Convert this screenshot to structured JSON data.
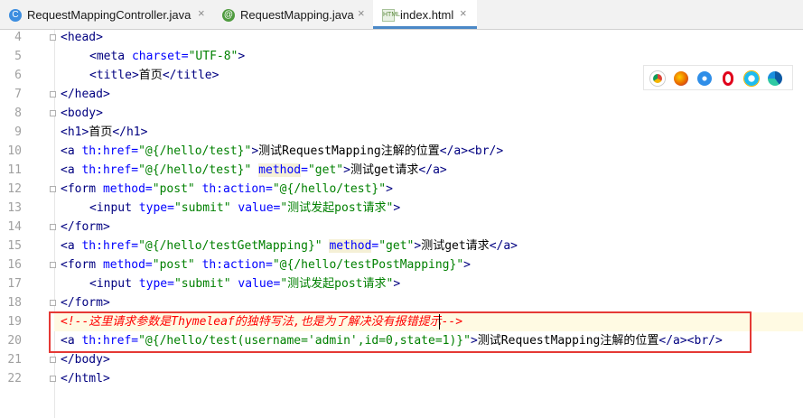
{
  "tabs": [
    {
      "label": "RequestMappingController.java",
      "icon": "java-class-icon",
      "active": false
    },
    {
      "label": "RequestMapping.java",
      "icon": "annotation-icon",
      "active": false
    },
    {
      "label": "index.html",
      "icon": "html-file-icon",
      "active": true
    }
  ],
  "tab_close_glyph": "×",
  "line_numbers": [
    "4",
    "5",
    "6",
    "7",
    "8",
    "9",
    "10",
    "11",
    "12",
    "13",
    "14",
    "15",
    "16",
    "17",
    "18",
    "19",
    "20",
    "21",
    "22"
  ],
  "code": {
    "l4": {
      "tag": "<head>"
    },
    "l5": {
      "t1": "<meta ",
      "a1": "charset=",
      "v1": "\"UTF-8\"",
      "t2": ">"
    },
    "l6": {
      "t1": "<title>",
      "x": "首页",
      "t2": "</title>"
    },
    "l7": {
      "tag": "</head>"
    },
    "l8": {
      "tag": "<body>"
    },
    "l9": {
      "t1": "<h1>",
      "x": "首页",
      "t2": "</h1>"
    },
    "l10": {
      "t1": "<a ",
      "a1": "th:href=",
      "v1": "\"@{/hello/test}\"",
      "t2": ">",
      "x": "测试RequestMapping注解的位置",
      "t3": "</a><br/>"
    },
    "l11": {
      "t1": "<a ",
      "a1": "th:href=",
      "v1": "\"@{/hello/test}\"",
      "sp": " ",
      "a2": "method",
      "a3": "=",
      "v2": "\"get\"",
      "t2": ">",
      "x": "测试get请求",
      "t3": "</a>"
    },
    "l12": {
      "t1": "<form ",
      "a1": "method=",
      "v1": "\"post\"",
      "sp": " ",
      "a2": "th:action=",
      "v2": "\"@{/hello/test}\"",
      "t2": ">"
    },
    "l13": {
      "t1": "<input ",
      "a1": "type=",
      "v1": "\"submit\"",
      "sp": " ",
      "a2": "value=",
      "v2": "\"测试发起post请求\"",
      "t2": ">"
    },
    "l14": {
      "tag": "</form>"
    },
    "l15": {
      "t1": "<a ",
      "a1": "th:href=",
      "v1": "\"@{/hello/testGetMapping}\"",
      "sp": " ",
      "a2": "method",
      "a3": "=",
      "v2": "\"get\"",
      "t2": ">",
      "x": "测试get请求",
      "t3": "</a>"
    },
    "l16": {
      "t1": "<form ",
      "a1": "method=",
      "v1": "\"post\"",
      "sp": " ",
      "a2": "th:action=",
      "v2": "\"@{/hello/testPostMapping}\"",
      "t2": ">"
    },
    "l17": {
      "t1": "<input ",
      "a1": "type=",
      "v1": "\"submit\"",
      "sp": " ",
      "a2": "value=",
      "v2": "\"测试发起post请求\"",
      "t2": ">"
    },
    "l18": {
      "tag": "</form>"
    },
    "l19": {
      "comment": "<!--这里请求参数是Thymeleaf的独特写法,也是为了解决没有报错提示-->"
    },
    "l20": {
      "t1": "<a ",
      "a1": "th:href=",
      "v1": "\"@{/hello/test(username='admin',id=0,state=1)}\"",
      "t2": ">",
      "x": "测试RequestMapping注解的位置",
      "t3": "</a><br/>"
    },
    "l21": {
      "tag": "</body>"
    },
    "l22": {
      "tag": "</html>"
    }
  },
  "browser_icons": [
    "chrome-icon",
    "firefox-icon",
    "safari-icon",
    "opera-icon",
    "internet-explorer-icon",
    "edge-icon"
  ],
  "colors": {
    "tag": "#000080",
    "attribute": "#0000ff",
    "string": "#008000",
    "comment": "#ff0000",
    "highlight_box": "#e53935",
    "active_tab_underline": "#4a88c7"
  }
}
